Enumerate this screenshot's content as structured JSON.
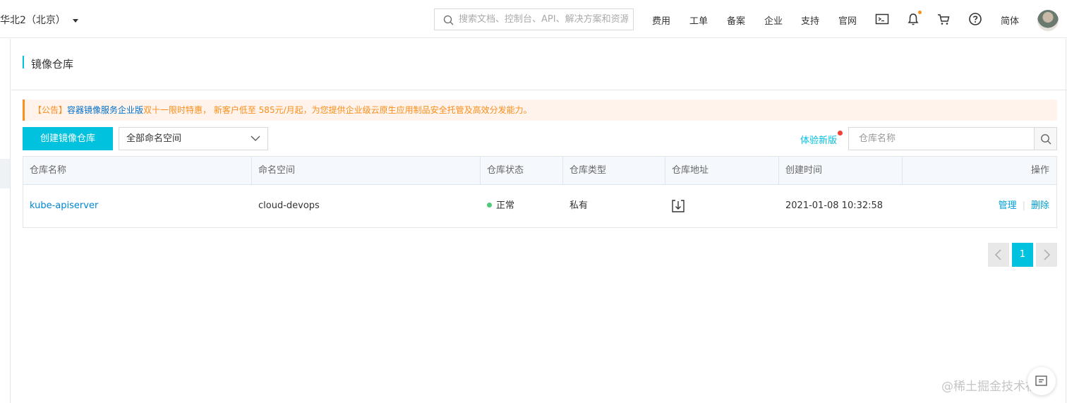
{
  "topbar": {
    "region": "华北2（北京）",
    "search_placeholder": "搜索文档、控制台、API、解决方案和资源",
    "links": [
      "费用",
      "工单",
      "备案",
      "企业",
      "支持",
      "官网"
    ],
    "language": "简体"
  },
  "page": {
    "title": "镜像仓库"
  },
  "notice": {
    "tag": "【公告】",
    "product_link": "容器镜像服务企业版",
    "promo": "双十一限时特惠",
    "text": "， 新客户低至 585元/月起，为您提供企业级云原生应用制品安全托管及高效分发能力。"
  },
  "toolbar": {
    "create_button": "创建镜像仓库",
    "namespace_select": "全部命名空间",
    "try_new": "体验新版",
    "repo_search_placeholder": "仓库名称"
  },
  "table": {
    "columns": [
      "仓库名称",
      "命名空间",
      "仓库状态",
      "仓库类型",
      "仓库地址",
      "创建时间",
      "操作"
    ],
    "rows": [
      {
        "name": "kube-apiserver",
        "namespace": "cloud-devops",
        "status": "正常",
        "type": "私有",
        "created": "2021-01-08 10:32:58",
        "actions": [
          "管理",
          "删除"
        ]
      }
    ]
  },
  "pagination": {
    "current": "1"
  },
  "watermark": "@稀土掘金技术社区",
  "colors": {
    "accent": "#00c1de",
    "notice": "#f98e1a",
    "link": "#0086d6",
    "status_ok": "#4ecb73"
  }
}
